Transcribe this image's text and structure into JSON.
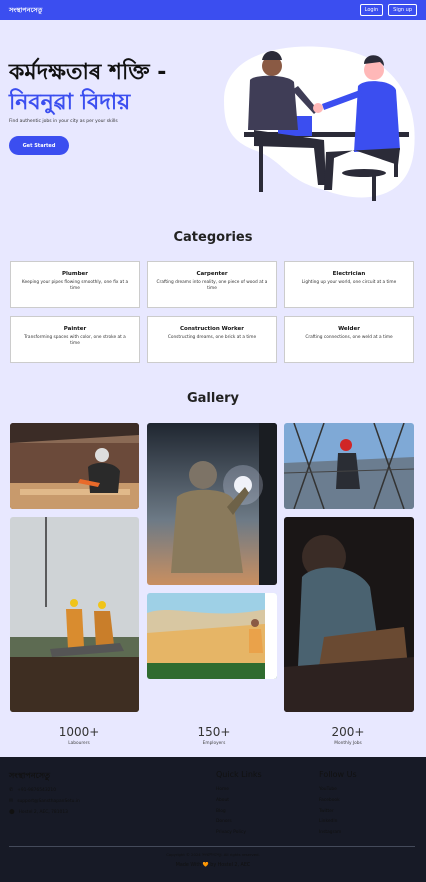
{
  "nav": {
    "brand": "সংস্থাপনসেতু",
    "login": "Login",
    "signup": "Sign up"
  },
  "hero": {
    "title_line1": "কৰ্মদক্ষতাৰ শক্তি -",
    "title_line2": "নিবনুৱা বিদায়",
    "subtitle": "Find authentic jobs in your city as per your skills",
    "cta": "Get Started"
  },
  "categories": {
    "title": "Categories",
    "items": [
      {
        "name": "Plumber",
        "desc": "Keeping your pipes flowing smoothly, one fix at a time"
      },
      {
        "name": "Carpenter",
        "desc": "Crafting dreams into reality, one piece of wood at a time"
      },
      {
        "name": "Electrician",
        "desc": "Lighting up your world, one circuit at a time"
      },
      {
        "name": "Painter",
        "desc": "Transforming spaces with color, one stroke at a time"
      },
      {
        "name": "Construction Worker",
        "desc": "Constructing dreams, one brick at a time"
      },
      {
        "name": "Welder",
        "desc": "Crafting connections, one weld at a time"
      }
    ]
  },
  "gallery": {
    "title": "Gallery"
  },
  "stats": [
    {
      "value": "1000+",
      "label": "Labourers"
    },
    {
      "value": "150+",
      "label": "Employers"
    },
    {
      "value": "200+",
      "label": "Monthly Jobs"
    }
  ],
  "footer": {
    "brand": "সংস্থাপনসেতু",
    "phone": "+91-9876543210",
    "email": "support@SansthapanSetu.in",
    "address": "Hostel 2, AEC, 781013",
    "quick_links_title": "Quick Links",
    "quick_links": [
      "Home",
      "About",
      "Blog",
      "Donors",
      "Privacy Policy"
    ],
    "follow_title": "Follow Us",
    "follow_links": [
      "YouTube",
      "Facebook",
      "Twitter",
      "LinkedIn",
      "Instagram"
    ],
    "copyright": "Copyright © 2024 সংস্থাপনসেতু. All rights reserved.",
    "made_with": "Made With 🧡 by Hostel 2, AEC"
  },
  "colors": {
    "primary": "#3b4ef0",
    "background": "#e8e8ff",
    "footer": "#171a26"
  }
}
